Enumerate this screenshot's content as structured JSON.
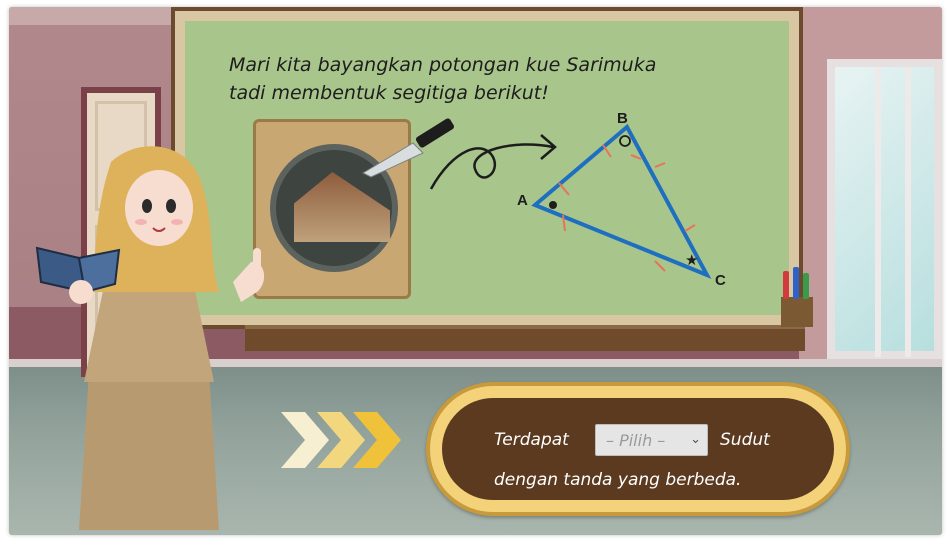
{
  "board": {
    "title_line1": "Mari kita bayangkan potongan kue Sarimuka",
    "title_line2": "tadi membentuk segitiga berikut!"
  },
  "triangle": {
    "vertex_a": "A",
    "vertex_b": "B",
    "vertex_c": "C",
    "angle_a_mark": "dot",
    "angle_b_mark": "circle",
    "angle_c_mark": "star",
    "star_glyph": "★",
    "color": "#1f6fc1"
  },
  "answer_panel": {
    "prefix": "Terdapat",
    "select_placeholder": "– Pilih –",
    "suffix": "Sudut",
    "line2": "dengan tanda yang berbeda."
  },
  "colors": {
    "board": "#a8c58c",
    "panel_inner": "#5b3a20",
    "panel_border": "#f4d27a",
    "chevron": "#f0c23a"
  }
}
